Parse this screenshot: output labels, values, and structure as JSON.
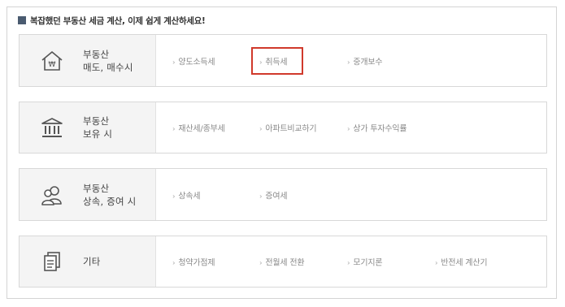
{
  "header": {
    "icon": "square-icon",
    "title": "복잡했던 부동산 세금 계산, 이제 쉽게 계산하세요!"
  },
  "rows": [
    {
      "icon": "house-won-icon",
      "label1": "부동산",
      "label2": "매도, 매수시",
      "links": [
        {
          "label": "양도소득세"
        },
        {
          "label": "취득세",
          "highlighted": true
        },
        {
          "label": "중개보수"
        }
      ]
    },
    {
      "icon": "bank-building-icon",
      "label1": "부동산",
      "label2": "보유 시",
      "links": [
        {
          "label": "재산세/종부세"
        },
        {
          "label": "아파트비교하기"
        },
        {
          "label": "상가 투자수익률"
        }
      ]
    },
    {
      "icon": "people-icon",
      "label1": "부동산",
      "label2": "상속, 증여 시",
      "links": [
        {
          "label": "상속세"
        },
        {
          "label": "증여세"
        }
      ]
    },
    {
      "icon": "documents-icon",
      "label1": "기타",
      "label2": "",
      "links": [
        {
          "label": "청약가점제"
        },
        {
          "label": "전월세 전환"
        },
        {
          "label": "모기지론"
        },
        {
          "label": "반전세 계산기"
        }
      ]
    }
  ],
  "highlight_color": "#d0392b",
  "link_chevron": "›"
}
